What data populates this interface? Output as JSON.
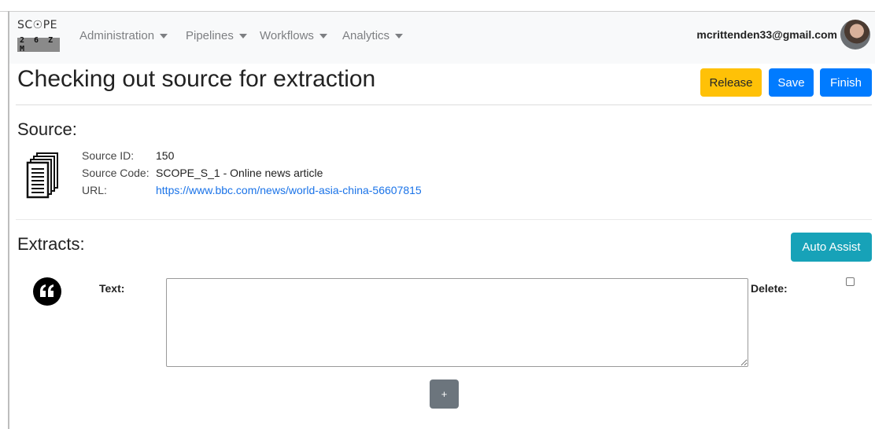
{
  "app": {
    "logo_top": "SC☉PE",
    "logo_bottom": "2 6 Z M"
  },
  "nav": {
    "items": [
      {
        "label": "Administration"
      },
      {
        "label": "Pipelines"
      },
      {
        "label": "Workflows"
      },
      {
        "label": "Analytics"
      }
    ],
    "user_email": "mcrittenden33@gmail.com"
  },
  "page": {
    "title": "Checking out source for extraction",
    "buttons": {
      "release": "Release",
      "save": "Save",
      "finish": "Finish"
    }
  },
  "source": {
    "heading": "Source:",
    "id_label": "Source ID:",
    "id_value": "150",
    "code_label": "Source Code:",
    "code_value": "SCOPE_S_1 - Online news article",
    "url_label": "URL:",
    "url_value": "https://www.bbc.com/news/world-asia-china-56607815"
  },
  "extracts": {
    "heading": "Extracts:",
    "auto_assist": "Auto Assist",
    "text_label": "Text:",
    "text_value": "",
    "delete_label": "Delete:",
    "delete_checked": false,
    "add_button": "+"
  },
  "colors": {
    "warning": "#ffc107",
    "primary": "#007bff",
    "info": "#17a2b8",
    "secondary": "#6c757d",
    "link": "#1a73e8",
    "navbar_bg": "#f8f9fa"
  },
  "icons": {
    "source": "document-stack-icon",
    "extract": "quote-icon",
    "nav_dropdown": "caret-down-icon"
  }
}
